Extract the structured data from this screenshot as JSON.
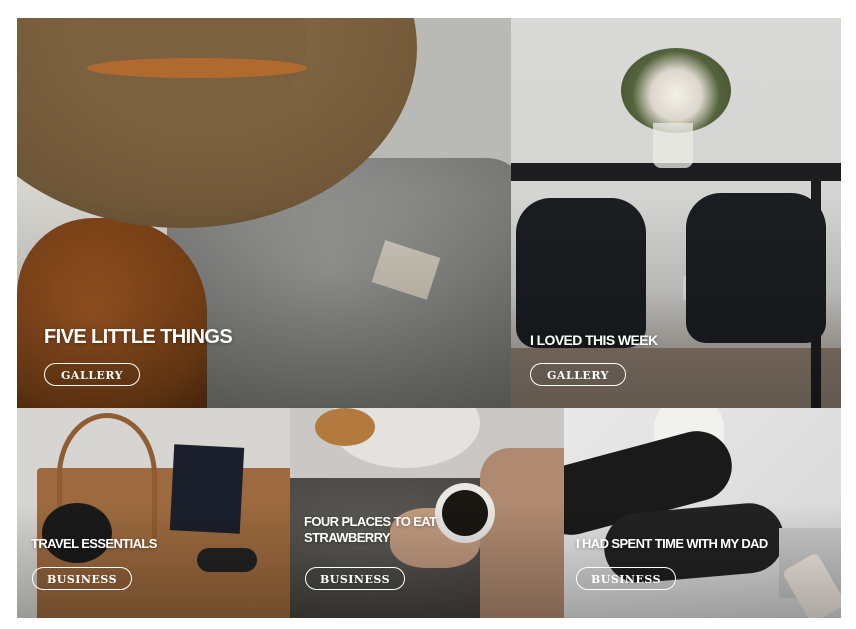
{
  "posts": [
    {
      "title": "FIVE LITTLE THINGS",
      "category": "GALLERY"
    },
    {
      "title": "I LOVED THIS WEEK",
      "category": "GALLERY"
    },
    {
      "title": "TRAVEL ESSENTIALS",
      "category": "BUSINESS"
    },
    {
      "title": "FOUR PLACES TO EAT STRAWBERRY",
      "category": "BUSINESS"
    },
    {
      "title": "I HAD SPENT TIME WITH MY DAD",
      "category": "BUSINESS"
    }
  ]
}
